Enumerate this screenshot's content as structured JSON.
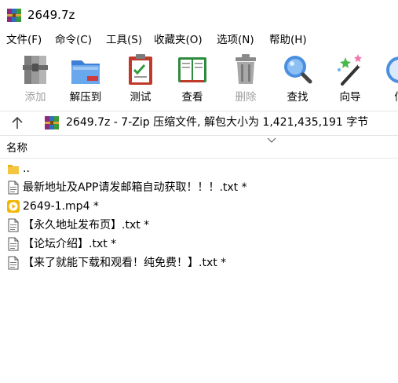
{
  "window": {
    "title": "2649.7z"
  },
  "menu": [
    {
      "label": "文件(F)"
    },
    {
      "label": "命令(C)"
    },
    {
      "label": "工具(S)"
    },
    {
      "label": "收藏夹(O)"
    },
    {
      "label": "选项(N)"
    },
    {
      "label": "帮助(H)"
    }
  ],
  "toolbar": [
    {
      "label": "添加",
      "icon": "add-archive-icon",
      "enabled": false
    },
    {
      "label": "解压到",
      "icon": "extract-folder-icon",
      "enabled": true
    },
    {
      "label": "测试",
      "icon": "test-clipboard-icon",
      "enabled": true
    },
    {
      "label": "查看",
      "icon": "view-book-icon",
      "enabled": true
    },
    {
      "label": "删除",
      "icon": "trash-icon",
      "enabled": false
    },
    {
      "label": "查找",
      "icon": "magnifier-icon",
      "enabled": true
    },
    {
      "label": "向导",
      "icon": "wizard-wand-icon",
      "enabled": true
    },
    {
      "label": "信",
      "icon": "info-icon",
      "enabled": true
    }
  ],
  "address": {
    "up_icon": "up-arrow-icon",
    "text": "2649.7z - 7-Zip 压缩文件, 解包大小为 1,421,435,191 字节"
  },
  "list": {
    "header": "名称",
    "rows": [
      {
        "name": "..",
        "icon": "folder-icon"
      },
      {
        "name": "最新地址及APP请发邮箱自动获取！！！.txt *",
        "icon": "text-file-icon"
      },
      {
        "name": "2649-1.mp4 *",
        "icon": "video-file-icon"
      },
      {
        "name": "【永久地址发布页】.txt *",
        "icon": "text-file-icon"
      },
      {
        "name": "【论坛介绍】.txt *",
        "icon": "text-file-icon"
      },
      {
        "name": "【来了就能下载和观看！纯免费！】.txt *",
        "icon": "text-file-icon"
      }
    ]
  },
  "colors": {
    "disabled_text": "#a0a0a0",
    "folder": "#f5c542",
    "video": "#f2b705"
  }
}
